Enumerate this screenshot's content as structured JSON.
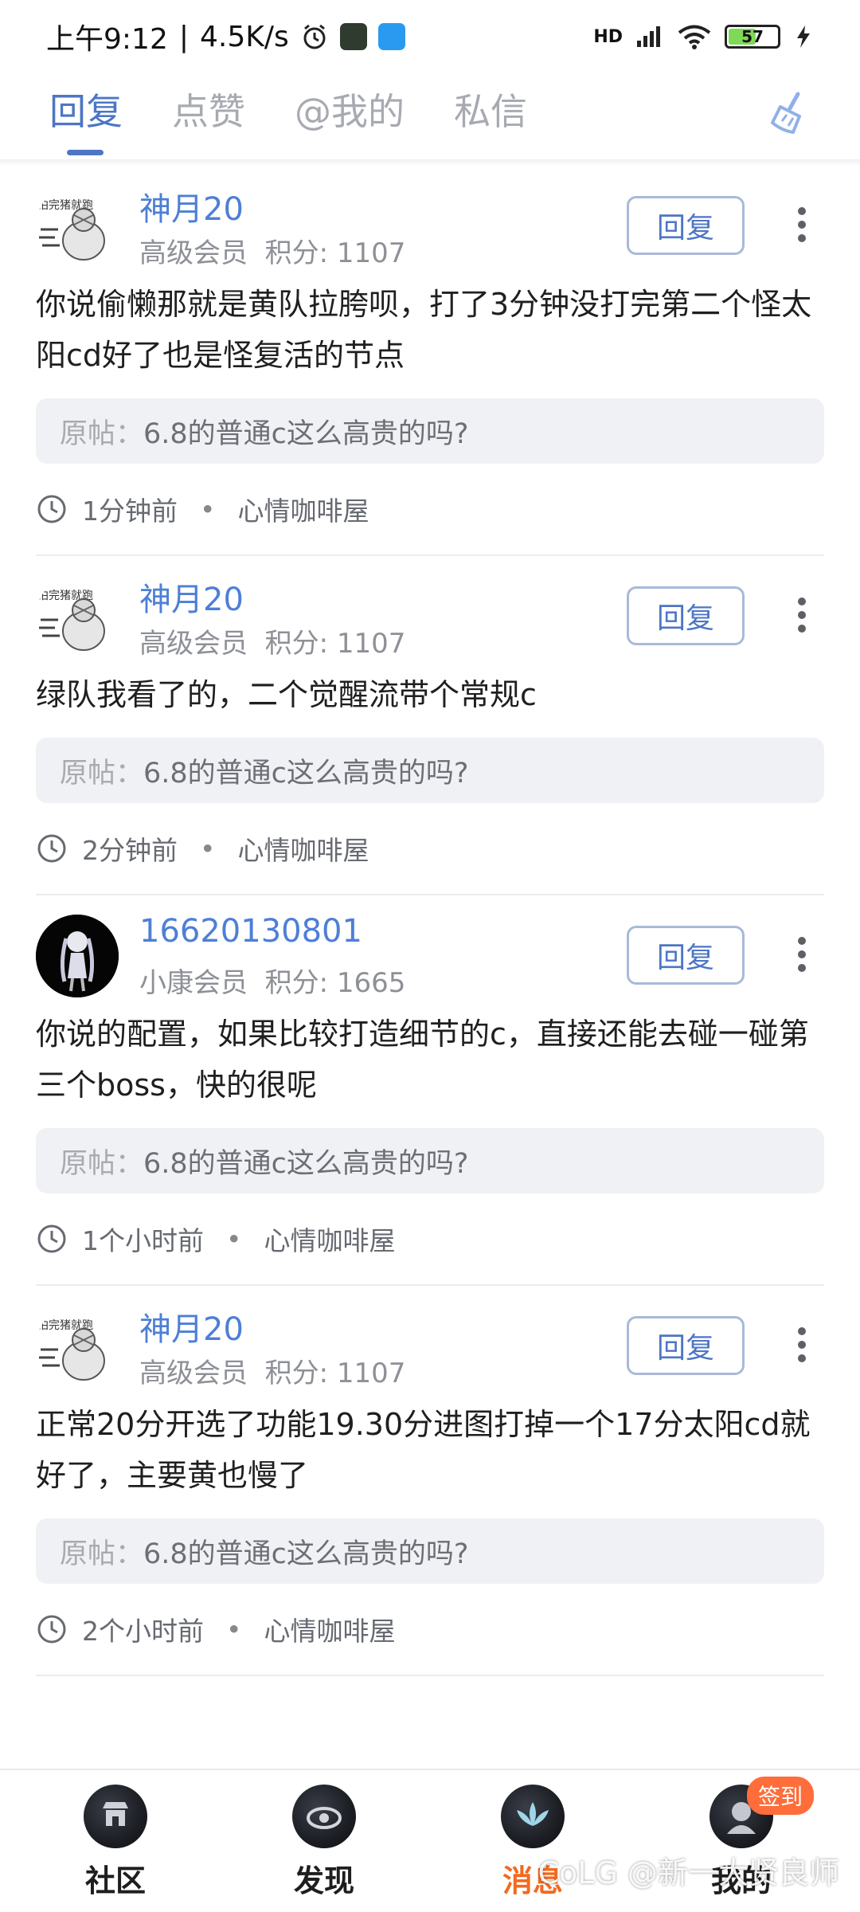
{
  "status_bar": {
    "time": "上午9:12",
    "net_speed": "4.5K/s",
    "network": "HD",
    "battery": "57",
    "battery_level": 0.57
  },
  "tabs": [
    {
      "label": "回复",
      "active": true
    },
    {
      "label": "点赞",
      "active": false
    },
    {
      "label": "@我的",
      "active": false
    },
    {
      "label": "私信",
      "active": false
    }
  ],
  "reply_button_label": "回复",
  "quote_prefix": "原帖：",
  "messages": [
    {
      "username": "神月20",
      "level": "高级会员",
      "score_text": "积分: 1107",
      "body": "你说偷懒那就是黄队拉胯呗，打了3分钟没打完第二个怪太阳cd好了也是怪复活的节点",
      "quote": "6.8的普通c这么高贵的吗?",
      "time": "1分钟前",
      "forum": "心情咖啡屋"
    },
    {
      "username": "神月20",
      "level": "高级会员",
      "score_text": "积分: 1107",
      "body": "绿队我看了的，二个觉醒流带个常规c",
      "quote": "6.8的普通c这么高贵的吗?",
      "time": "2分钟前",
      "forum": "心情咖啡屋"
    },
    {
      "username": "16620130801",
      "level": "小康会员",
      "score_text": "积分: 1665",
      "body": "你说的配置，如果比较打造细节的c，直接还能去碰一碰第三个boss，快的很呢",
      "quote": "6.8的普通c这么高贵的吗?",
      "time": "1个小时前",
      "forum": "心情咖啡屋"
    },
    {
      "username": "神月20",
      "level": "高级会员",
      "score_text": "积分: 1107",
      "body": "正常20分开选了功能19.30分进图打掉一个17分太阳cd就好了，主要黄也慢了",
      "quote": "6.8的普通c这么高贵的吗?",
      "time": "2个小时前",
      "forum": "心情咖啡屋"
    }
  ],
  "bottom_nav": [
    {
      "label": "社区",
      "active": false
    },
    {
      "label": "发现",
      "active": false
    },
    {
      "label": "消息",
      "active": true
    },
    {
      "label": "我的",
      "active": false,
      "badge": "签到"
    }
  ],
  "watermark": "CoLG @新一大贤良师",
  "colors": {
    "accent": "#4d76c4",
    "username": "#4d7fd6",
    "active_nav": "#f26a1f",
    "badge": "#ff6d3a"
  }
}
